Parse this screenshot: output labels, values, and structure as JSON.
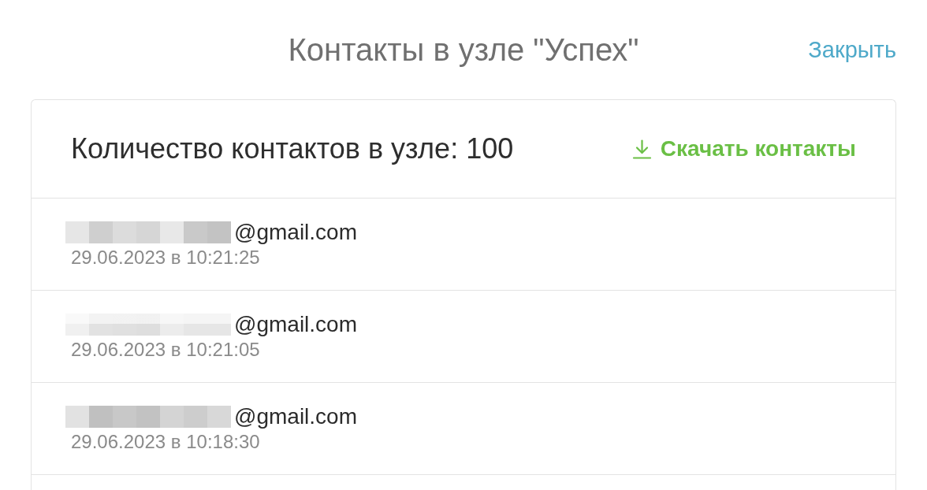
{
  "title": "Контакты в узле \"Успех\"",
  "close_link": "Закрыть",
  "card": {
    "count_label": "Количество контактов в узле: 100",
    "download_link": "Скачать контакты",
    "contacts": [
      {
        "email": "@gmail.com",
        "date": "29.06.2023 в 10:21:25"
      },
      {
        "email": "@gmail.com",
        "date": "29.06.2023 в 10:21:05"
      },
      {
        "email": "@gmail.com",
        "date": "29.06.2023 в 10:18:30"
      }
    ]
  }
}
